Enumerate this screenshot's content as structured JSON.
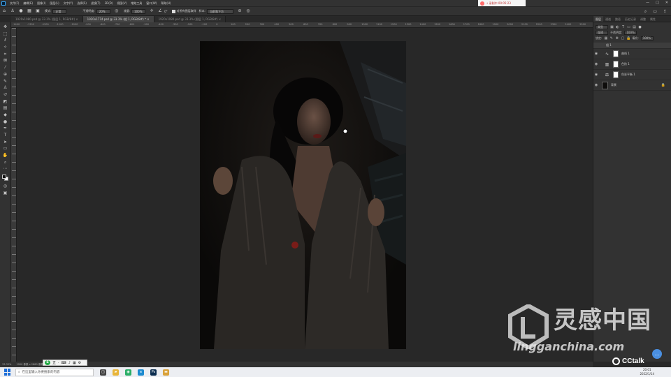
{
  "menubar": {
    "items": [
      "文件(F)",
      "编辑(E)",
      "图像(I)",
      "图层(L)",
      "文字(Y)",
      "选择(S)",
      "滤镜(T)",
      "3D(D)",
      "视图(V)",
      "增效工具",
      "窗口(W)",
      "帮助(H)"
    ],
    "notification": "• 录制中 00:05:23",
    "window_controls": [
      "—",
      "□",
      "✕"
    ]
  },
  "options_bar": {
    "mode_label": "模式:",
    "mode_value": "正常",
    "opacity_label": "不透明度:",
    "opacity_value": "20%",
    "flow_label": "流量:",
    "flow_value": "100%",
    "smoothing_value": "0°",
    "sample_checkbox_label": "对所有图层取样",
    "sample_label": "样本:",
    "sample_value": "当前和下方",
    "right_icons": [
      "search-icon",
      "workspace-icon",
      "share-icon"
    ]
  },
  "tabs": [
    {
      "label": "1920x1080.psd @ 33.3% (图层 1, RGB/8#) ×",
      "active": false
    },
    {
      "label": "1920x1774.psd @ 33.3% (组 1, RGB/8#) * ×",
      "active": true
    },
    {
      "label": "1920x1080.psd @ 33.3% (图层 1, RGB/8#) ×",
      "active": false
    }
  ],
  "ruler": {
    "labels": [
      "-1400",
      "-1300",
      "-1200",
      "-1100",
      "-1000",
      "-900",
      "-800",
      "-700",
      "-600",
      "-500",
      "-400",
      "-300",
      "-200",
      "-100",
      "0",
      "100",
      "200",
      "300",
      "400",
      "500",
      "600",
      "700",
      "800",
      "900",
      "1000",
      "1100",
      "1200",
      "1300",
      "1400",
      "1500",
      "1600",
      "1700",
      "1800",
      "1900",
      "2000",
      "2100",
      "2200",
      "2300",
      "2400",
      "2500"
    ]
  },
  "toolbar": {
    "tools": [
      {
        "name": "move-icon",
        "glyph": "✥"
      },
      {
        "name": "marquee-icon",
        "glyph": "⬚"
      },
      {
        "name": "lasso-icon",
        "glyph": "ℓ"
      },
      {
        "name": "magic-wand-icon",
        "glyph": "✧"
      },
      {
        "name": "crop-icon",
        "glyph": "⌗"
      },
      {
        "name": "frame-icon",
        "glyph": "⊠"
      },
      {
        "name": "eyedropper-icon",
        "glyph": "⁄"
      },
      {
        "name": "healing-brush-icon",
        "glyph": "⊕"
      },
      {
        "name": "brush-icon",
        "glyph": "✎"
      },
      {
        "name": "clone-stamp-icon",
        "glyph": "♙"
      },
      {
        "name": "history-brush-icon",
        "glyph": "↺"
      },
      {
        "name": "eraser-icon",
        "glyph": "◩"
      },
      {
        "name": "gradient-icon",
        "glyph": "▤"
      },
      {
        "name": "blur-icon",
        "glyph": "◆"
      },
      {
        "name": "dodge-icon",
        "glyph": "●"
      },
      {
        "name": "pen-icon",
        "glyph": "✒"
      },
      {
        "name": "type-icon",
        "glyph": "T"
      },
      {
        "name": "path-select-icon",
        "glyph": "➤"
      },
      {
        "name": "rectangle-icon",
        "glyph": "▭"
      },
      {
        "name": "hand-icon",
        "glyph": "✋"
      },
      {
        "name": "zoom-icon",
        "glyph": "⌕"
      },
      {
        "name": "more-tools-icon",
        "glyph": "⋯"
      }
    ],
    "quick_mask_glyph": "◎",
    "screen_mode_glyph": "▣"
  },
  "panel": {
    "tabs": [
      {
        "label": "图层",
        "active": true
      },
      {
        "label": "通道",
        "active": false
      },
      {
        "label": "路径",
        "active": false
      },
      {
        "label": "历史记录",
        "active": false
      },
      {
        "label": "调整",
        "active": false
      },
      {
        "label": "属性",
        "active": false
      }
    ],
    "filter_label": "类型",
    "blend_mode": "穿透",
    "opacity_label": "不透明度:",
    "opacity_value": "100%",
    "lock_label": "锁定:",
    "fill_label": "填充:",
    "fill_value": "100%",
    "layers": [
      {
        "type": "group",
        "name": "组 1",
        "eye": ""
      },
      {
        "type": "adjustment",
        "name": "曲线 1",
        "adj_glyph": "∿",
        "eye": "◉"
      },
      {
        "type": "adjustment",
        "name": "色阶 1",
        "adj_glyph": "▥",
        "eye": "◉"
      },
      {
        "type": "adjustment",
        "name": "色彩平衡 1",
        "adj_glyph": "⚖",
        "eye": "◉"
      },
      {
        "type": "background",
        "name": "背景",
        "eye": "◉",
        "lock": "🔒"
      }
    ]
  },
  "statusbar": {
    "zoom": "33.33%",
    "doc_info": "1920 像素 x 2880 像素 (72 ppi)"
  },
  "ime": {
    "logo": "S",
    "items": [
      "五",
      "·",
      "⌨",
      "♪",
      "▦",
      "⚙"
    ]
  },
  "taskbar": {
    "search_placeholder": "在这里输入你要搜索的内容",
    "apps": [
      {
        "name": "task-view-icon",
        "glyph": "◫",
        "color": "#444444"
      },
      {
        "name": "explorer-icon",
        "glyph": "▰",
        "color": "#e8b53a"
      },
      {
        "name": "wechat-icon",
        "glyph": "◉",
        "color": "#2aae67"
      },
      {
        "name": "edge-icon",
        "glyph": "e",
        "color": "#1e8bd0"
      },
      {
        "name": "photoshop-icon",
        "glyph": "Ps",
        "color": "#0b2d4f"
      },
      {
        "name": "folder-icon",
        "glyph": "▬",
        "color": "#d9a23b"
      }
    ],
    "time": "20:01",
    "date": "2022/1/14"
  },
  "watermark": {
    "cn_text": "灵感中国",
    "url": "lingganchina.com",
    "cctalk": "CCtalk"
  },
  "colors": {
    "accent": "#31a8ff",
    "ui_bg": "#323232",
    "canvas_bg": "#282828"
  }
}
